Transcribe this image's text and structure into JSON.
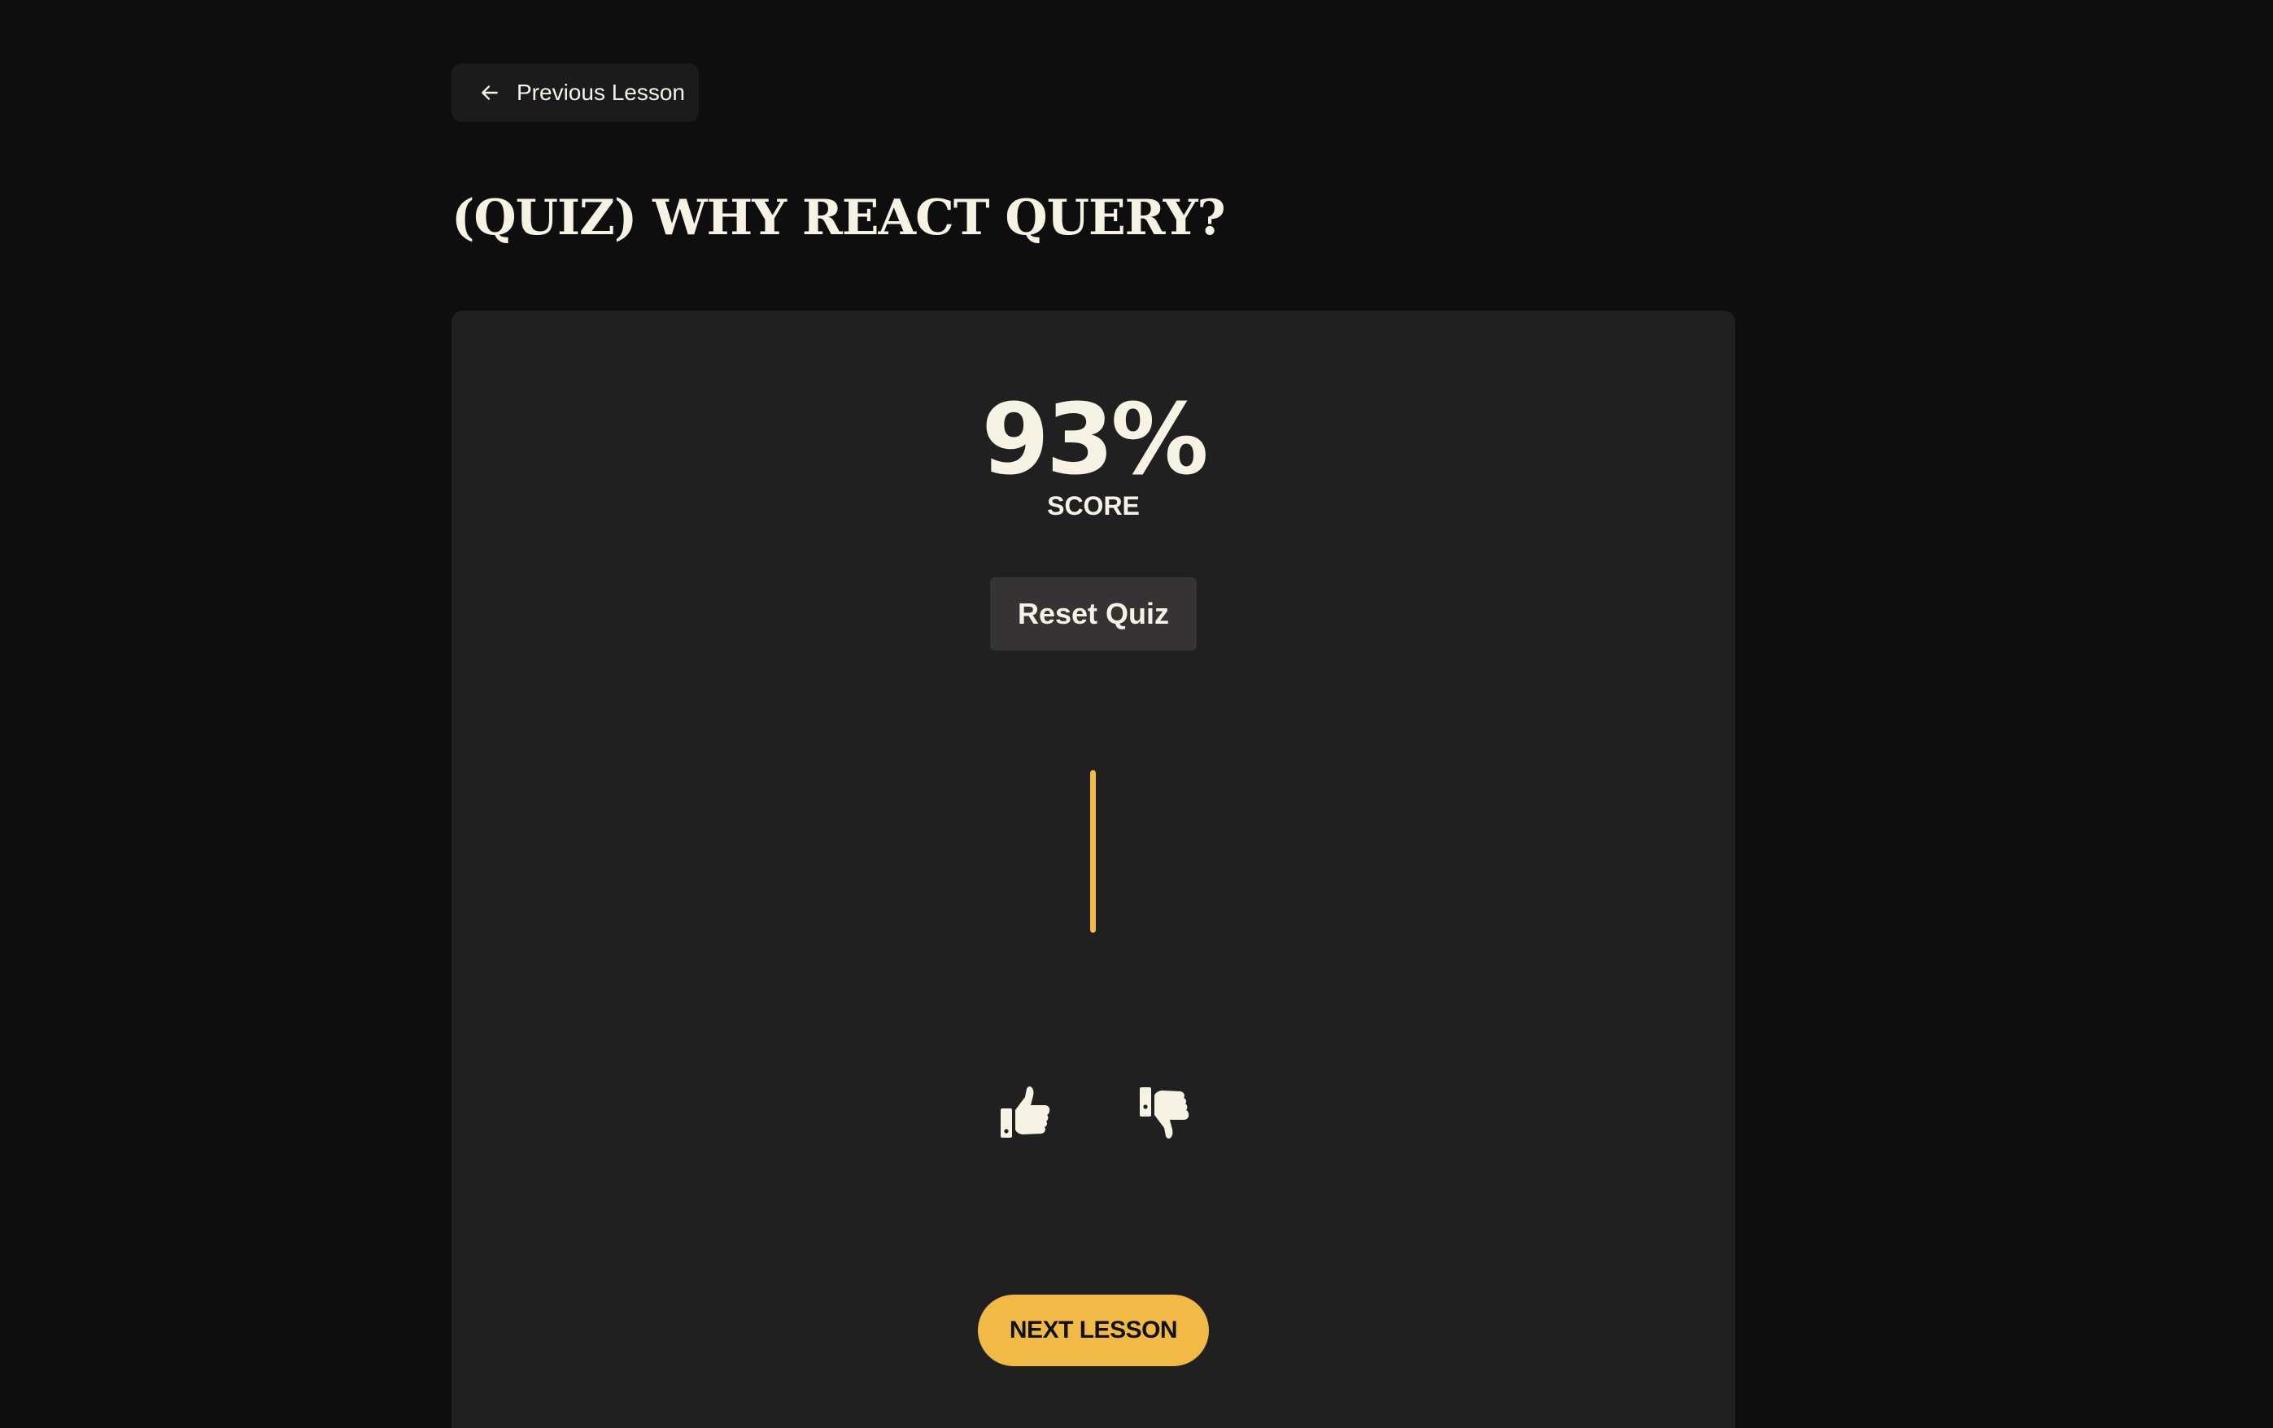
{
  "navigation": {
    "previous_label": "Previous Lesson",
    "previous_icon": "arrow-left-icon"
  },
  "page": {
    "title": "(QUIZ) WHY REACT QUERY?"
  },
  "quiz": {
    "score_value": "93%",
    "score_label": "SCORE",
    "reset_label": "Reset Quiz"
  },
  "feedback": {
    "like_icon": "thumbs-up-icon",
    "dislike_icon": "thumbs-down-icon"
  },
  "footer": {
    "next_label": "NEXT LESSON"
  },
  "colors": {
    "background": "#0f0e0f",
    "card": "#212021",
    "accent": "#f1b945",
    "text": "#f6f2e4"
  }
}
